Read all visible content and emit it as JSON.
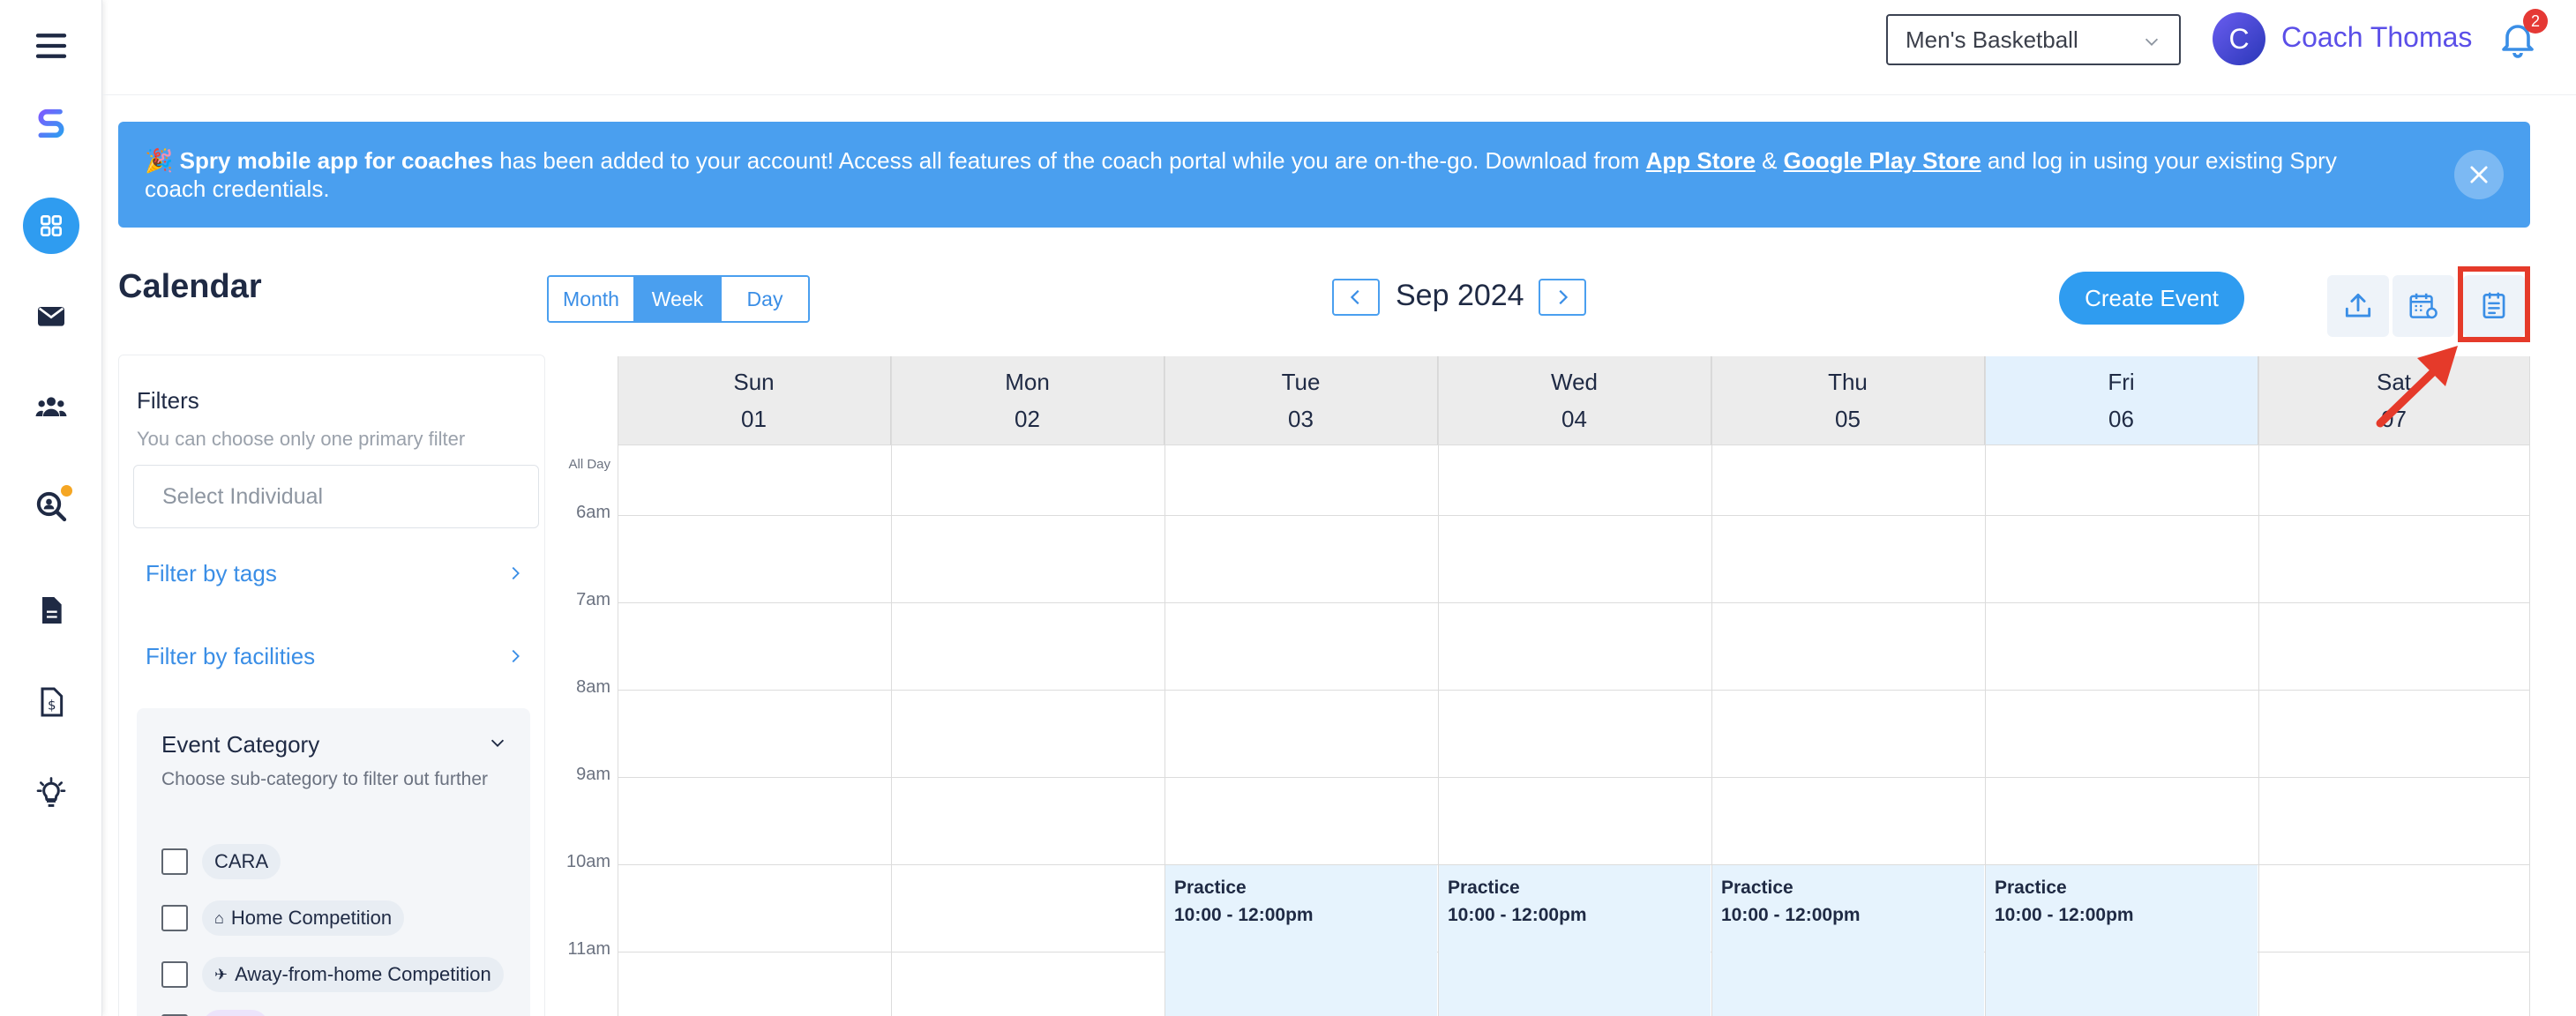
{
  "team_select": {
    "value": "Men's Basketball"
  },
  "user": {
    "initial": "C",
    "name": "Coach Thomas",
    "notification_count": "2"
  },
  "banner": {
    "emoji": "🎉",
    "app_name": "Spry mobile app for coaches",
    "text1": " has been added to your account! Access all features of the coach portal while you are on-the-go. Download from ",
    "app_store": "App Store",
    "amp": " & ",
    "play_store": "Google Play Store",
    "text2": " and log in using your existing Spry coach credentials."
  },
  "calendar": {
    "title": "Calendar",
    "views": [
      "Month",
      "Week",
      "Day"
    ],
    "active_view": "Week",
    "month_label": "Sep 2024",
    "create_label": "Create Event"
  },
  "filters": {
    "title": "Filters",
    "subtitle": "You can choose only one primary filter",
    "individual_placeholder": "Select Individual",
    "by_tags": "Filter by tags",
    "by_facilities": "Filter by facilities",
    "category": {
      "title": "Event Category",
      "subtitle": "Choose sub-category to filter out further",
      "items": [
        "CARA",
        "Home Competition",
        "Away-from-home Competition"
      ]
    }
  },
  "days": [
    {
      "name": "Sun",
      "date": "01"
    },
    {
      "name": "Mon",
      "date": "02"
    },
    {
      "name": "Tue",
      "date": "03"
    },
    {
      "name": "Wed",
      "date": "04"
    },
    {
      "name": "Thu",
      "date": "05"
    },
    {
      "name": "Fri",
      "date": "06"
    },
    {
      "name": "Sat",
      "date": "07"
    }
  ],
  "times": [
    "All Day",
    "6am",
    "7am",
    "8am",
    "9am",
    "10am",
    "11am"
  ],
  "events": [
    {
      "title": "Practice",
      "time": "10:00 - 12:00pm"
    },
    {
      "title": "Practice",
      "time": "10:00 - 12:00pm"
    },
    {
      "title": "Practice",
      "time": "10:00 - 12:00pm"
    },
    {
      "title": "Practice",
      "time": "10:00 - 12:00pm"
    }
  ],
  "colors": {
    "primary": "#2f9cf0",
    "banner": "#4a9fef",
    "highlight": "#e53a2a",
    "event_bg": "#e6f3fd"
  }
}
